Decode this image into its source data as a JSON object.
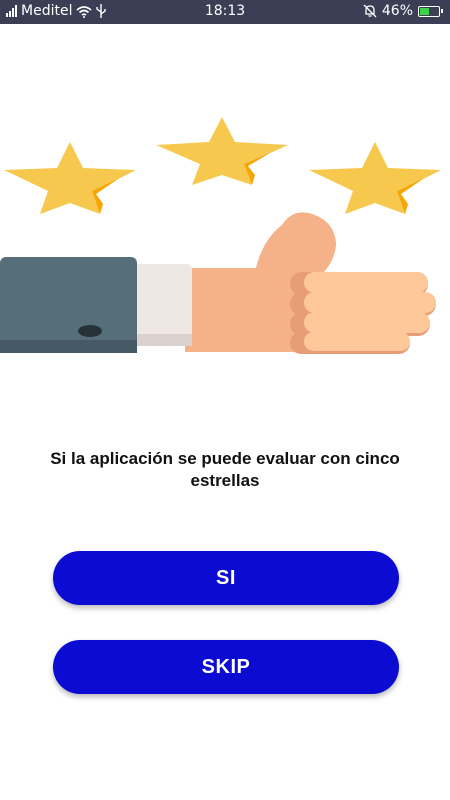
{
  "status_bar": {
    "carrier": "Meditel",
    "time": "18:13",
    "battery": "46%"
  },
  "icons": {
    "signal": "signal-icon",
    "wifi": "wifi-icon",
    "usb": "usb-icon",
    "mute": "bell-off-icon",
    "battery": "battery-charging-icon",
    "illustration": "thumbs-up-five-stars-illustration"
  },
  "rating": {
    "stars": 3
  },
  "prompt": {
    "question": "Si la aplicación se puede evaluar con cinco estrellas"
  },
  "buttons": {
    "yes_label": "SI",
    "skip_label": "SKIP"
  },
  "colors": {
    "status_bar": "#3a3f56",
    "button": "#0c0bd2",
    "star": "#f6c94e",
    "star_accent": "#f7a500",
    "sleeve": "#566e7a",
    "skin": "#f5b187"
  }
}
